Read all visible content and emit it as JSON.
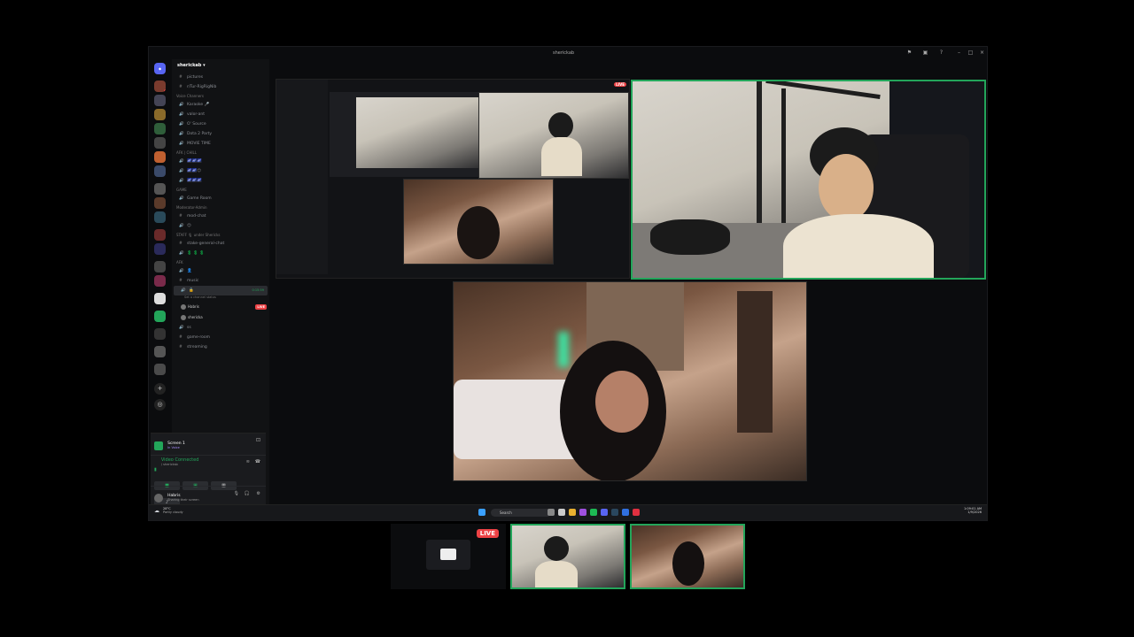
{
  "window": {
    "title": "sherickab"
  },
  "server": {
    "name": "sherickab"
  },
  "channels": [
    {
      "type": "text",
      "label": "pictures"
    },
    {
      "type": "text",
      "label": "r/Tur-RigRigNib"
    },
    {
      "type": "category",
      "label": "Voice Channers"
    },
    {
      "type": "voice",
      "label": "Karaoke 🎤"
    },
    {
      "type": "voice",
      "label": "valor-ant"
    },
    {
      "type": "voice",
      "label": "O' Source"
    },
    {
      "type": "voice",
      "label": "Dota 2 Party"
    },
    {
      "type": "voice",
      "label": "MOVIE TIME"
    },
    {
      "type": "category",
      "label": "AFK | CHILL"
    },
    {
      "type": "voice",
      "label": "🌌🌌🌌"
    },
    {
      "type": "voice",
      "label": "🌌🌌😊"
    },
    {
      "type": "voice",
      "label": "🌌🌌🌌"
    },
    {
      "type": "category",
      "label": "GAME"
    },
    {
      "type": "voice",
      "label": "Game Room"
    },
    {
      "type": "category",
      "label": "Moderator-Admin"
    },
    {
      "type": "text",
      "label": "mod-chat"
    },
    {
      "type": "voice",
      "label": "😊"
    },
    {
      "type": "category",
      "label": "STAFF 🎙 under Shericks"
    },
    {
      "type": "text",
      "label": "stake-general-chat"
    },
    {
      "type": "voice",
      "label": "💲 💲 💲"
    },
    {
      "type": "category",
      "label": "AFK"
    },
    {
      "type": "voice",
      "label": "👤"
    },
    {
      "type": "text",
      "label": "music"
    },
    {
      "type": "voice",
      "label": "🔒",
      "selected": true,
      "sublabel": "Set a channel status",
      "time": "0:15:59"
    }
  ],
  "voice_users": [
    {
      "name": "Habris",
      "live": true,
      "live_label": "LIVE"
    },
    {
      "name": "shericka"
    }
  ],
  "channels_after": [
    {
      "type": "voice",
      "label": "ss"
    },
    {
      "type": "text",
      "label": "game-room"
    },
    {
      "type": "text",
      "label": "streaming"
    }
  ],
  "panel": {
    "screen_label": "Screen 1",
    "screen_sub": "In Voice",
    "voice_status": "Video Connected",
    "voice_sub": "/ shericksb",
    "user_name": "Habris",
    "user_status": "Sharing their screen"
  },
  "taskbar": {
    "search_placeholder": "Search",
    "weather": "28°C",
    "weather_sub": "Partly cloudy",
    "time": "1:09:01 AM",
    "date": "1/9/2026"
  },
  "stream": {
    "live_label": "LIVE"
  },
  "bottom_strip": {
    "live_label": "LIVE"
  },
  "colors": {
    "accent": "#23a55a",
    "live": "#ed4245",
    "bg": "#000000",
    "sidebar": "#111214"
  }
}
